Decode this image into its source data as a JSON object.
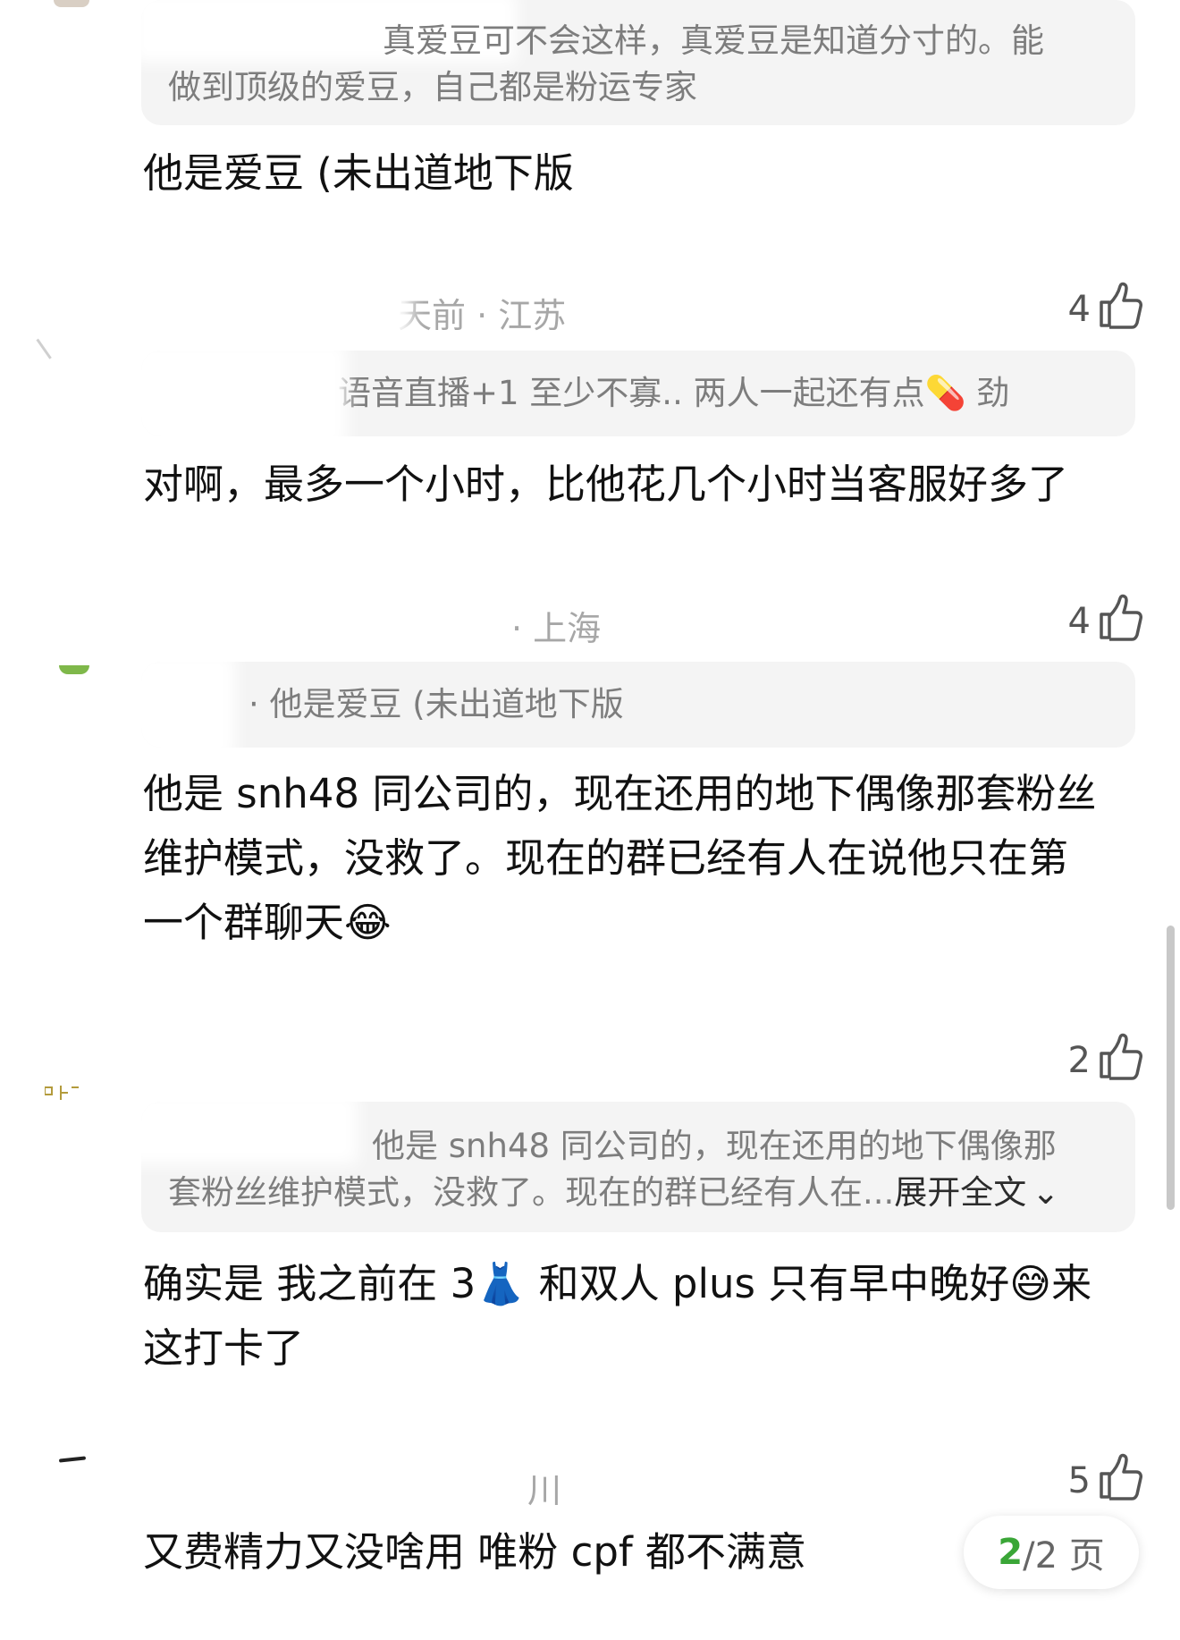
{
  "comments": [
    {
      "quote_lines": [
        "真爱豆可不会这样，真爱豆是知道分寸的。能",
        "做到顶级的爱豆，自己都是粉运专家"
      ],
      "body_lines": [
        "他是爱豆 (未出道地下版"
      ]
    },
    {
      "meta": "天前 · 江苏",
      "likes": "4",
      "quote_lines": [
        "语音直播+1 至少不寡.. 两人一起还有点💊 劲"
      ],
      "body_lines": [
        "对啊，最多一个小时，比他花几个小时当客服好多了"
      ]
    },
    {
      "meta": "· 上海",
      "likes": "4",
      "quote_lines": [
        "· 他是爱豆 (未出道地下版"
      ],
      "body_lines": [
        "他是 snh48 同公司的，现在还用的地下偶像那套粉丝",
        "维护模式，没救了。现在的群已经有人在说他只在第",
        "一个群聊天😂"
      ]
    },
    {
      "likes": "2",
      "quote_lines": [
        "他是 snh48 同公司的，现在还用的地下偶像那",
        "套粉丝维护模式，没救了。现在的群已经有人在..."
      ],
      "expand_label": "展开全文",
      "body_lines": [
        "确实是 我之前在 3👗 和双人 plus 只有早中晚好😅来",
        "这打卡了"
      ]
    },
    {
      "meta": "川",
      "likes": "5",
      "body_lines": [
        "又费精力又没啥用 唯粉 cpf 都不满意"
      ]
    }
  ],
  "pager": {
    "current": "2",
    "total": "/2 页"
  },
  "icons": {
    "like": "thumbs-up-icon",
    "expand": "chevron-down-icon"
  },
  "colors": {
    "pager_current": "#3aa637",
    "quote_bg": "#f4f4f4"
  }
}
